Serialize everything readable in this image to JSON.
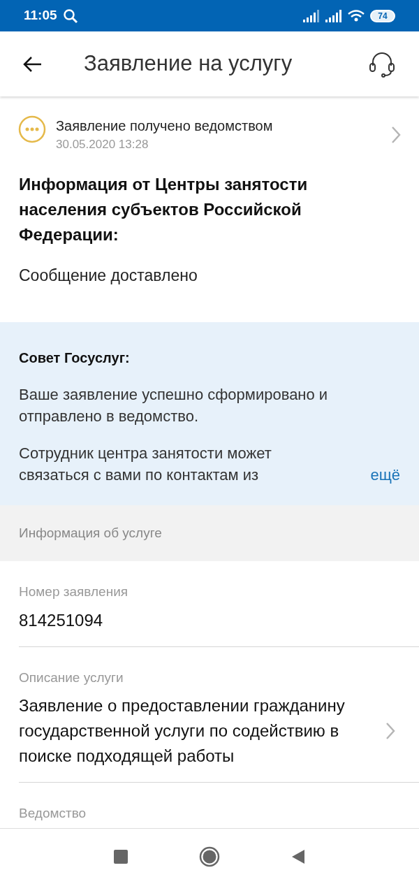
{
  "status_bar": {
    "time": "11:05",
    "battery": "74"
  },
  "header": {
    "title": "Заявление на услугу"
  },
  "status": {
    "text": "Заявление получено ведомством",
    "date": "30.05.2020 13:28"
  },
  "info": {
    "heading": "Информация от Центры занятости населения субъектов Российской Федерации:",
    "message": "Сообщение доставлено"
  },
  "tip": {
    "heading": "Совет Госуслуг:",
    "paragraphs": [
      "Ваше заявление успешно сформировано и отправлено в ведомство.",
      "Сотрудник центра занятости может связаться с вами по контактам из"
    ],
    "more": "ещё"
  },
  "section": {
    "title": "Информация об услуге"
  },
  "fields": [
    {
      "label": "Номер заявления",
      "value": "814251094",
      "link": false
    },
    {
      "label": "Описание услуги",
      "value": "Заявление о предоставлении гражданину государственной услуги по содействию в поиске подходящей работы",
      "link": true
    },
    {
      "label": "Ведомство"
    }
  ]
}
